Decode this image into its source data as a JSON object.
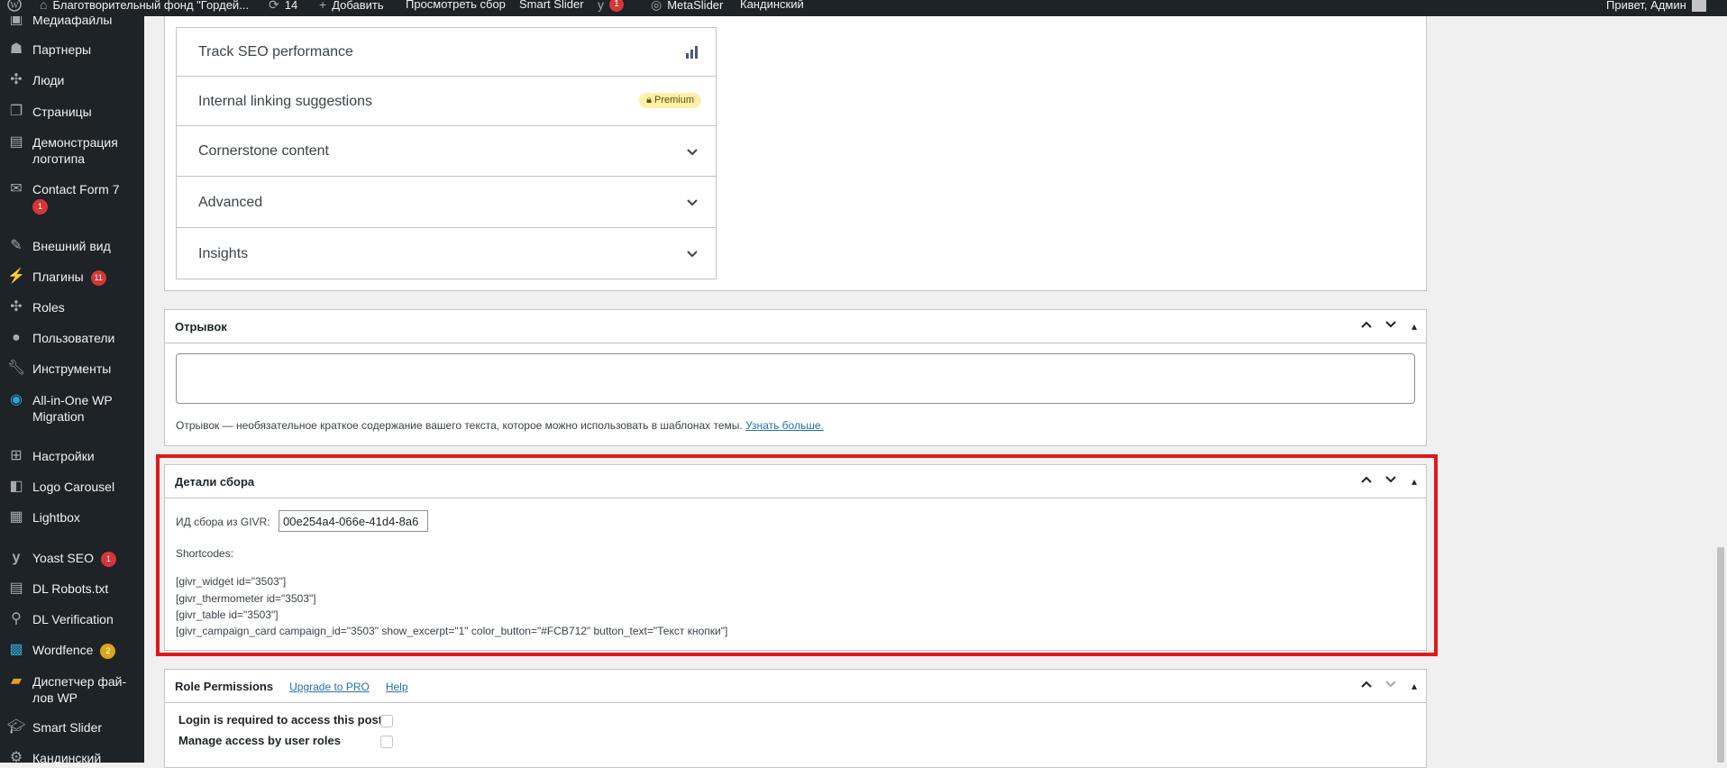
{
  "adminbar": {
    "site_name": "Благотворительный фонд \"Гордей...",
    "updates": "14",
    "add_new": "Добавить",
    "view": "Просмотреть сбор",
    "smart_slider": "Smart Slider",
    "yoast_badge": "1",
    "metaslider": "MetaSlider",
    "kandinsky": "Кандинский",
    "greeting": "Привет, Админ"
  },
  "sidebar": {
    "items": [
      {
        "label": "Медиафайлы",
        "icon": "media-icon"
      },
      {
        "label": "Партнеры",
        "icon": "partners-icon"
      },
      {
        "label": "Люди",
        "icon": "people-icon"
      },
      {
        "label": "Страницы",
        "icon": "pages-icon"
      },
      {
        "label": "Демонстрация логотипа",
        "icon": "logo-demo-icon"
      },
      {
        "label": "Contact Form 7",
        "icon": "mail-icon",
        "badge": "1"
      },
      {
        "label": "Внешний вид",
        "icon": "appearance-icon"
      },
      {
        "label": "Плагины",
        "icon": "plugins-icon",
        "badge": "11"
      },
      {
        "label": "Roles",
        "icon": "roles-icon"
      },
      {
        "label": "Пользователи",
        "icon": "users-icon"
      },
      {
        "label": "Инструменты",
        "icon": "tools-icon"
      },
      {
        "label": "All-in-One WP Migration",
        "icon": "migration-icon"
      },
      {
        "label": "Настройки",
        "icon": "settings-icon"
      },
      {
        "label": "Logo Carousel",
        "icon": "carousel-icon"
      },
      {
        "label": "Lightbox",
        "icon": "lightbox-icon"
      },
      {
        "label": "Yoast SEO",
        "icon": "yoast-icon",
        "badge": "1"
      },
      {
        "label": "DL Robots.txt",
        "icon": "robots-icon"
      },
      {
        "label": "DL Verification",
        "icon": "verification-icon"
      },
      {
        "label": "Wordfence",
        "icon": "wordfence-icon",
        "badge": "2"
      },
      {
        "label": "Диспетчер фай- лов WP",
        "icon": "file-manager-icon"
      },
      {
        "label": "Smart Slider",
        "icon": "smart-slider-icon"
      },
      {
        "label": "Кандинский",
        "icon": "kandinsky-icon"
      }
    ]
  },
  "seo": {
    "items": [
      {
        "label": "Track SEO performance"
      },
      {
        "label": "Internal linking suggestions",
        "premium": "Premium"
      },
      {
        "label": "Cornerstone content"
      },
      {
        "label": "Advanced"
      },
      {
        "label": "Insights"
      }
    ]
  },
  "excerpt": {
    "title": "Отрывок",
    "help_text": "Отрывок — необязательное краткое содержание вашего текста, которое можно использовать в шаблонах темы.",
    "learn_more": "Узнать больше."
  },
  "details": {
    "title": "Детали сбора",
    "givr_label": "ИД сбора из GIVR:",
    "givr_value": "00e254a4-066e-41d4-8a6",
    "shortcodes_label": "Shortcodes:",
    "shortcodes": [
      "[givr_widget id=\"3503\"]",
      "[givr_thermometer id=\"3503\"]",
      "[givr_table id=\"3503\"]",
      "[givr_campaign_card campaign_id=\"3503\" show_excerpt=\"1\" color_button=\"#FCB712\" button_text=\"Текст кнопки\"]"
    ]
  },
  "role_permissions": {
    "title": "Role Permissions",
    "upgrade": "Upgrade to PRO",
    "help": "Help",
    "login_required": "Login is required to access this post",
    "manage_access": "Manage access by user roles"
  },
  "colors": {
    "highlight": "#e01919",
    "admin_dark": "#1d2327",
    "badge_red": "#d63638",
    "badge_yellow": "#dba617",
    "link": "#2271b1"
  }
}
